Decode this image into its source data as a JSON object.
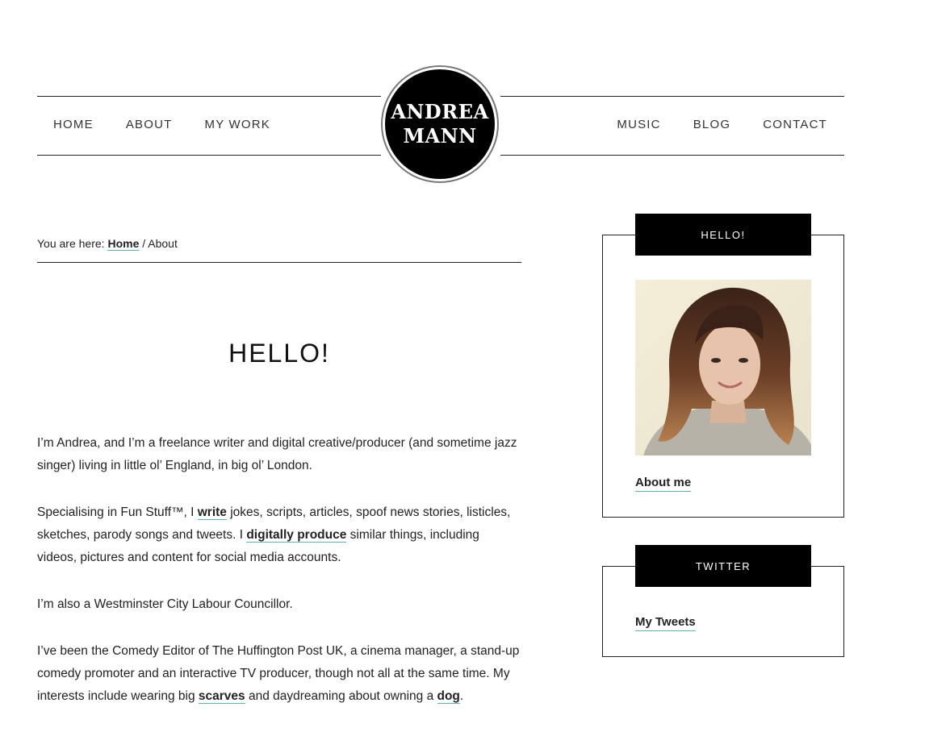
{
  "site": {
    "logo_line1": "ANDREA",
    "logo_line2": "MANN"
  },
  "nav": {
    "left": [
      "HOME",
      "ABOUT",
      "MY WORK"
    ],
    "right": [
      "MUSIC",
      "BLOG",
      "CONTACT"
    ]
  },
  "breadcrumb": {
    "prefix": "You are here: ",
    "home": "Home",
    "separator": " / ",
    "current": "About"
  },
  "main": {
    "title": "HELLO!",
    "p1": "I’m Andrea, and I’m a freelance writer and digital creative/producer (and sometime jazz singer) living in little ol’ England, in big ol’ London.",
    "p2_a": "Specialising in Fun Stuff™,  I ",
    "p2_link1": "write",
    "p2_b": " jokes, scripts, articles, spoof news stories, listicles, sketches, parody songs and tweets. I ",
    "p2_link2": "digitally produce",
    "p2_c": " similar things, including videos, pictures and content for social media accounts.",
    "p3": "I’m also a Westminster City Labour Councillor.",
    "p4_a": "I’ve been the Comedy Editor of The Huffington Post UK, a cinema manager, a stand-up comedy promoter and an interactive TV producer, though not all at the same time. My interests include wearing big ",
    "p4_link1": "scarves",
    "p4_b": " and daydreaming about owning a ",
    "p4_link2": "dog",
    "p4_c": "."
  },
  "sidebar": {
    "hello_title": "HELLO!",
    "hello_link": "About me",
    "twitter_title": "TWITTER",
    "twitter_link": "My Tweets"
  },
  "colors": {
    "accent_underline": "#5fb0b0",
    "text": "#222222",
    "widget_title_bg": "#000000"
  }
}
